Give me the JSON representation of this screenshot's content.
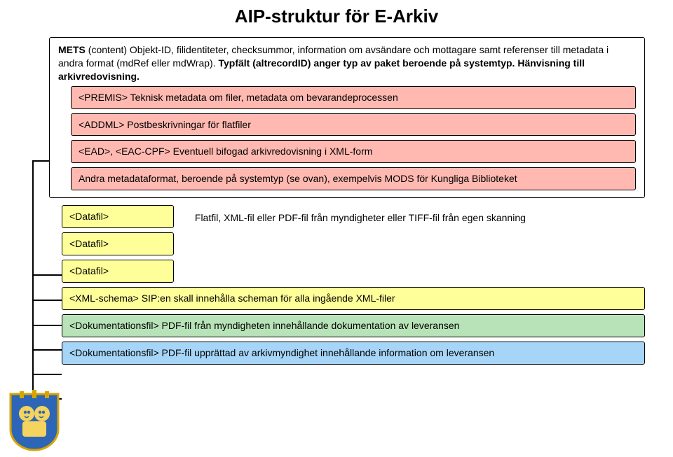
{
  "title": "AIP-struktur för E-Arkiv",
  "mets": {
    "heading_strong": "METS ",
    "heading_rest": "(content) Objekt-ID, filidentiteter, checksummor, information om avsändare och mottagare samt referenser till metadata i andra format (mdRef eller mdWrap). ",
    "typfalt_strong": "Typfält (altrecordID) anger typ av paket beroende på systemtyp. Hänvisning till arkivredovisning.",
    "premis": "<PREMIS> Teknisk metadata om filer, metadata om bevarandeprocessen",
    "addml": "<ADDML> Postbeskrivningar för flatfiler",
    "ead": "<EAD>, <EAC-CPF> Eventuell bifogad arkivredovisning i XML-form",
    "andra": "Andra metadataformat, beroende på systemtyp (se ovan), exempelvis MODS för Kungliga Biblioteket"
  },
  "datafil": {
    "label": "<Datafil>",
    "flatfil": "Flatfil, XML-fil eller PDF-fil från myndigheter eller TIFF-fil från egen skanning"
  },
  "xmlschema": "<XML-schema> SIP:en skall innehålla scheman för alla ingående XML-filer",
  "dok1": "<Dokumentationsfil> PDF-fil från myndigheten innehållande dokumentation av leveransen",
  "dok2": "<Dokumentationsfil> PDF-fil upprättad av arkivmyndighet innehållande information om leveransen"
}
